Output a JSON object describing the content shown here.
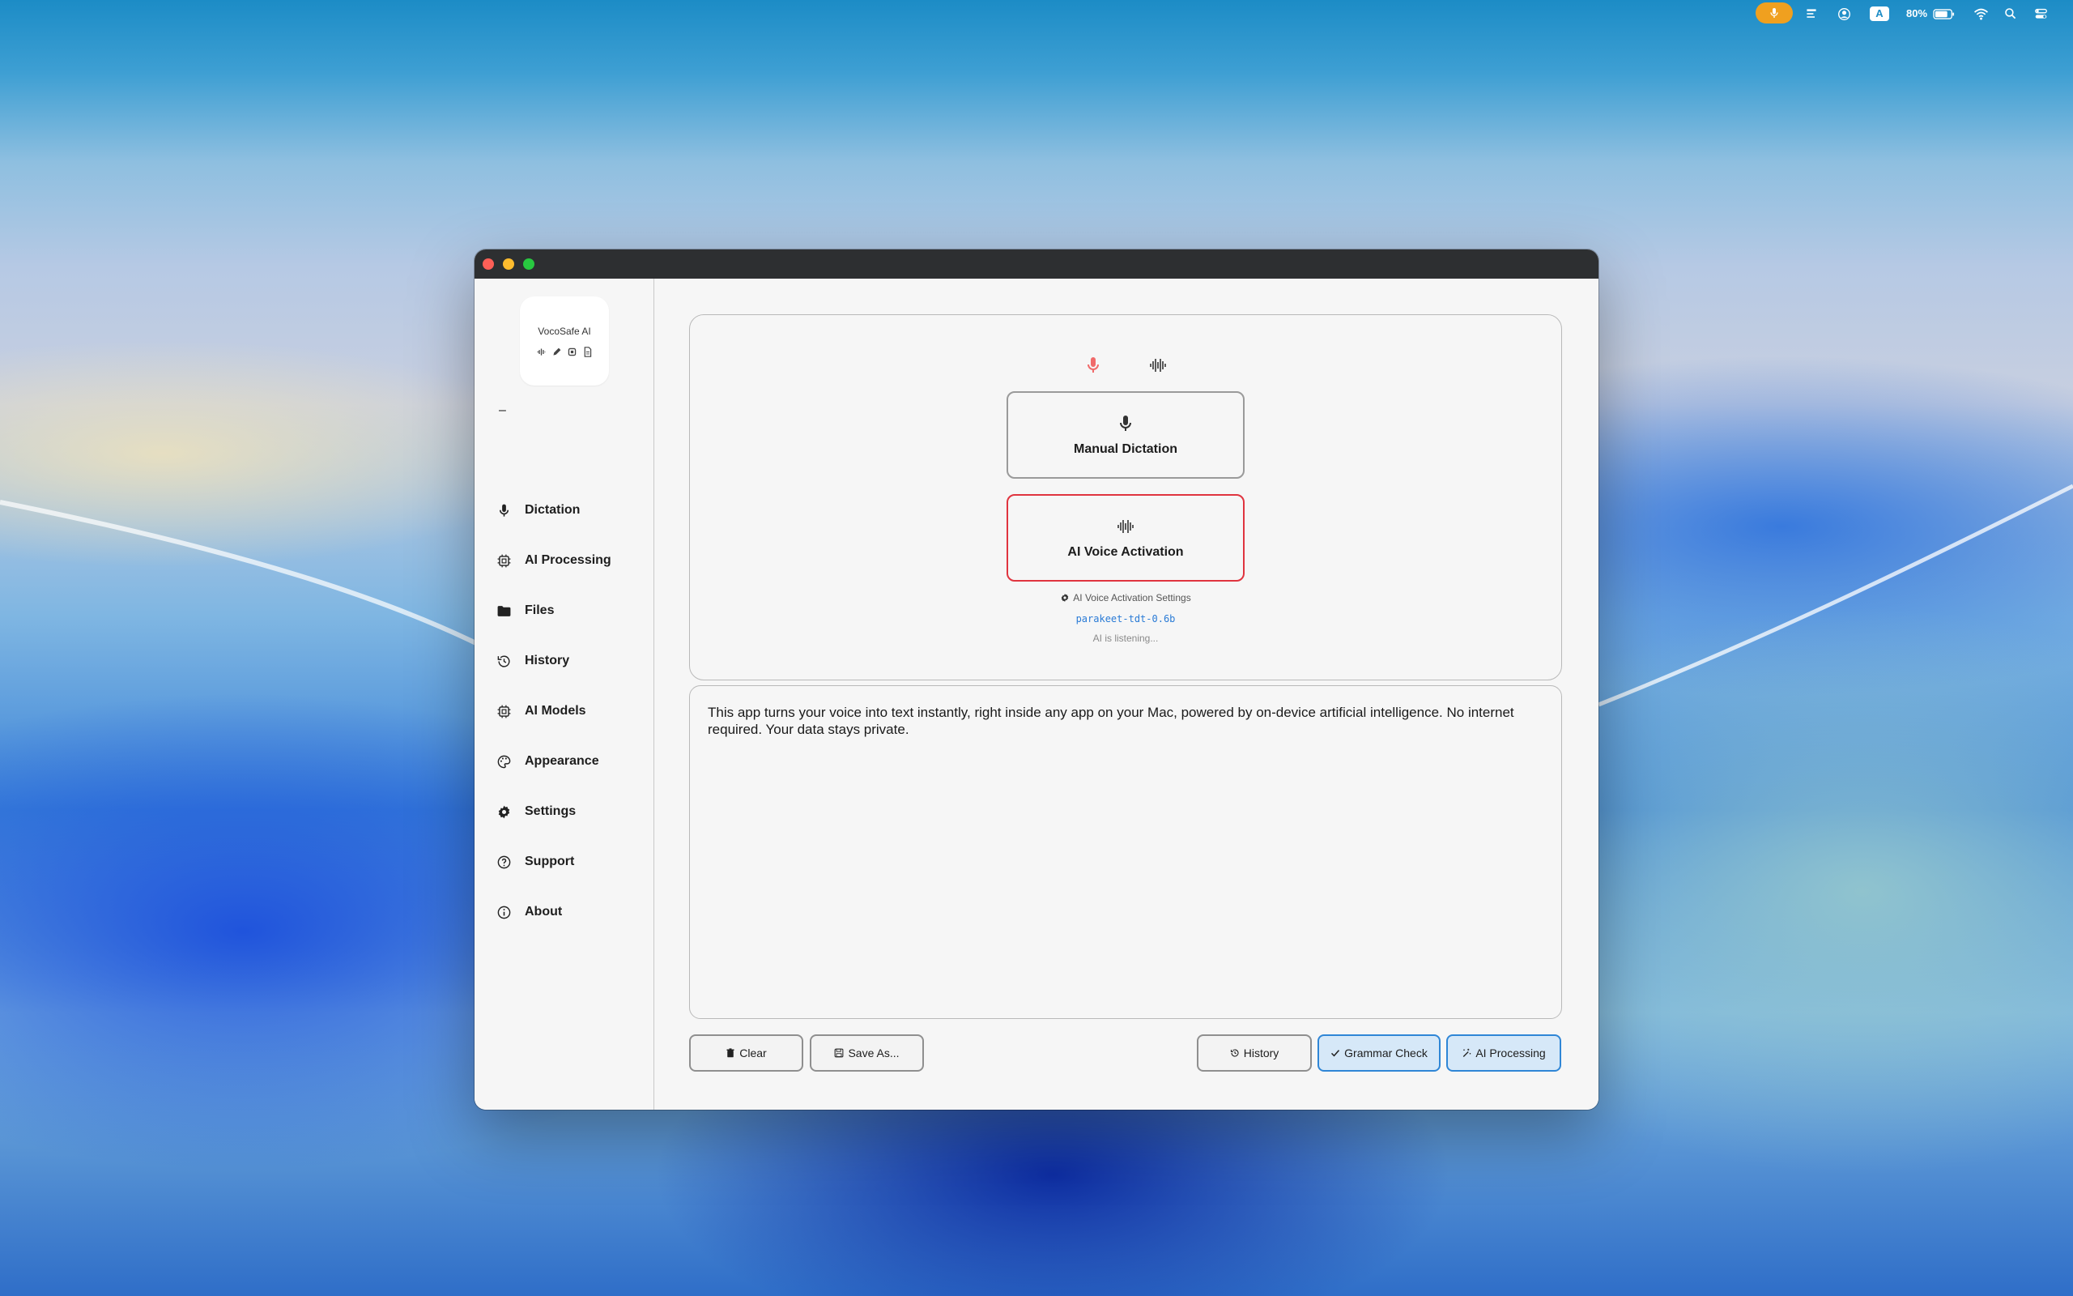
{
  "menubar": {
    "battery": "80%"
  },
  "app": {
    "logo_title": "VocoSafe AI",
    "collapse_glyph": "–"
  },
  "sidebar": {
    "items": [
      {
        "label": "Dictation",
        "icon": "mic-icon"
      },
      {
        "label": "AI Processing",
        "icon": "chip-icon"
      },
      {
        "label": "Files",
        "icon": "folder-icon"
      },
      {
        "label": "History",
        "icon": "history-icon"
      },
      {
        "label": "AI Models",
        "icon": "chip-icon"
      },
      {
        "label": "Appearance",
        "icon": "palette-icon"
      },
      {
        "label": "Settings",
        "icon": "gear-icon"
      },
      {
        "label": "Support",
        "icon": "question-icon"
      },
      {
        "label": "About",
        "icon": "info-icon"
      }
    ]
  },
  "dictation": {
    "manual_label": "Manual Dictation",
    "ai_label": "AI Voice Activation",
    "settings_link": "AI Voice Activation Settings",
    "model_name": "parakeet-tdt-0.6b",
    "status": "AI is listening..."
  },
  "transcript": {
    "text": "This app turns your voice into text instantly, right inside any app on your Mac, powered by on-device artificial intelligence. No internet required. Your data stays private."
  },
  "toolbar": {
    "clear": "Clear",
    "save_as": "Save As...",
    "history": "History",
    "grammar_check": "Grammar Check",
    "ai_processing": "AI Processing"
  },
  "colors": {
    "accent_red": "#e0343f",
    "accent_blue": "#2f86d6",
    "menubar_mic": "#f0a01f"
  }
}
